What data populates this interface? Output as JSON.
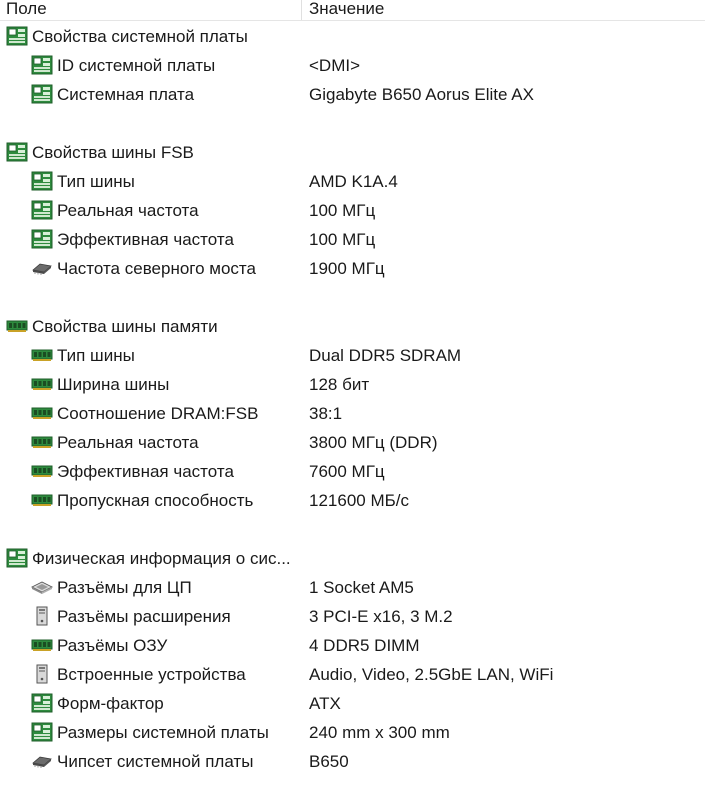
{
  "header": {
    "field": "Поле",
    "value": "Значение"
  },
  "sections": [
    {
      "title": "Свойства системной платы",
      "icon": "motherboard-icon",
      "items": [
        {
          "label": "ID системной платы",
          "value": "<DMI>",
          "icon": "motherboard-icon"
        },
        {
          "label": "Системная плата",
          "value": "Gigabyte B650 Aorus Elite AX",
          "icon": "motherboard-icon"
        }
      ]
    },
    {
      "title": "Свойства шины FSB",
      "icon": "motherboard-icon",
      "items": [
        {
          "label": "Тип шины",
          "value": "AMD K1A.4",
          "icon": "motherboard-icon"
        },
        {
          "label": "Реальная частота",
          "value": "100 МГц",
          "icon": "motherboard-icon"
        },
        {
          "label": "Эффективная частота",
          "value": "100 МГц",
          "icon": "motherboard-icon"
        },
        {
          "label": "Частота северного моста",
          "value": "1900 МГц",
          "icon": "chip-icon"
        }
      ]
    },
    {
      "title": "Свойства шины памяти",
      "icon": "memory-icon",
      "items": [
        {
          "label": "Тип шины",
          "value": "Dual DDR5 SDRAM",
          "icon": "memory-icon"
        },
        {
          "label": "Ширина шины",
          "value": "128 бит",
          "icon": "memory-icon"
        },
        {
          "label": "Соотношение DRAM:FSB",
          "value": "38:1",
          "icon": "memory-icon"
        },
        {
          "label": "Реальная частота",
          "value": "3800 МГц (DDR)",
          "icon": "memory-icon"
        },
        {
          "label": "Эффективная частота",
          "value": "7600 МГц",
          "icon": "memory-icon"
        },
        {
          "label": "Пропускная способность",
          "value": "121600 МБ/с",
          "icon": "memory-icon"
        }
      ]
    },
    {
      "title": "Физическая информация о сис...",
      "icon": "motherboard-icon",
      "items": [
        {
          "label": "Разъёмы для ЦП",
          "value": "1 Socket AM5",
          "icon": "cpu-socket-icon"
        },
        {
          "label": "Разъёмы расширения",
          "value": "3 PCI-E x16, 3 M.2",
          "icon": "pc-tower-icon"
        },
        {
          "label": "Разъёмы ОЗУ",
          "value": "4 DDR5 DIMM",
          "icon": "memory-icon"
        },
        {
          "label": "Встроенные устройства",
          "value": "Audio, Video, 2.5GbE LAN, WiFi",
          "icon": "pc-tower-icon"
        },
        {
          "label": "Форм-фактор",
          "value": "ATX",
          "icon": "motherboard-icon"
        },
        {
          "label": "Размеры системной платы",
          "value": "240 mm x 300 mm",
          "icon": "motherboard-icon"
        },
        {
          "label": "Чипсет системной платы",
          "value": "B650",
          "icon": "chip-icon"
        }
      ]
    }
  ]
}
